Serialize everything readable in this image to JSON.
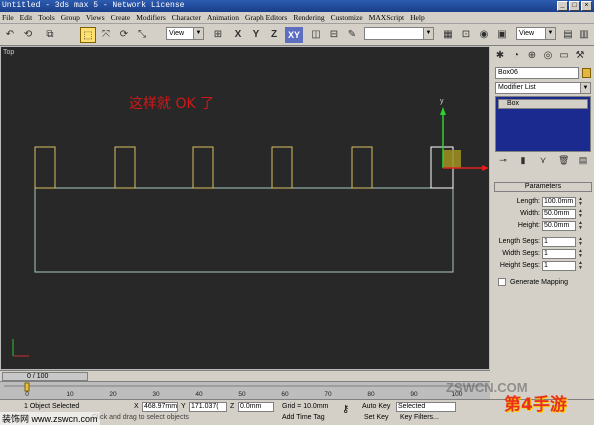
{
  "title": "Untitled - 3ds max 5 - Network License",
  "window_buttons": [
    "_",
    "□",
    "×"
  ],
  "menu": [
    "File",
    "Edit",
    "Tools",
    "Group",
    "Views",
    "Create",
    "Modifiers",
    "Character",
    "Animation",
    "Graph Editors",
    "Rendering",
    "Customize",
    "MAXScript",
    "Help"
  ],
  "toolbar": {
    "view_dropdown": "View",
    "view_dropdown2": "View",
    "axes": [
      "X",
      "Y",
      "Z",
      "XY"
    ]
  },
  "viewport": {
    "label": "Top",
    "caption": "这样就 OK 了"
  },
  "command_panel": {
    "object_name": "Box06",
    "modifier_list": "Modifier List",
    "stack_item": "Box",
    "rollout_title": "Parameters",
    "params": [
      {
        "label": "Length:",
        "value": "100.0mm"
      },
      {
        "label": "Width:",
        "value": "50.0mm"
      },
      {
        "label": "Height:",
        "value": "50.0mm"
      },
      {
        "label": "Length Segs:",
        "value": "1"
      },
      {
        "label": "Width Segs:",
        "value": "1"
      },
      {
        "label": "Height Segs:",
        "value": "1"
      }
    ],
    "generate_mapping": "Generate Mapping",
    "object_color": "#e2b641"
  },
  "timeline": {
    "slider_text": "0 / 100",
    "ticks": [
      "0",
      "10",
      "20",
      "30",
      "40",
      "50",
      "60",
      "70",
      "80",
      "90",
      "100"
    ]
  },
  "status": {
    "selected": "1 Object Selected",
    "prompt": "Click and drag to select objects",
    "x_label": "X",
    "x": "468.97mm",
    "y_label": "Y",
    "y": "171.037(",
    "z_label": "Z",
    "z": "0.0mm",
    "grid": "Grid = 10.0mm",
    "auto_key": "Auto Key",
    "set_key": "Set Key",
    "selected_dropdown": "Selected",
    "key_filters": "Key Filters...",
    "add_time_tag": "Add Time Tag"
  },
  "watermarks": {
    "left": "装饰网 www.zswcn.com",
    "mid": "ZSWCN.COM",
    "right": "第4手游"
  }
}
